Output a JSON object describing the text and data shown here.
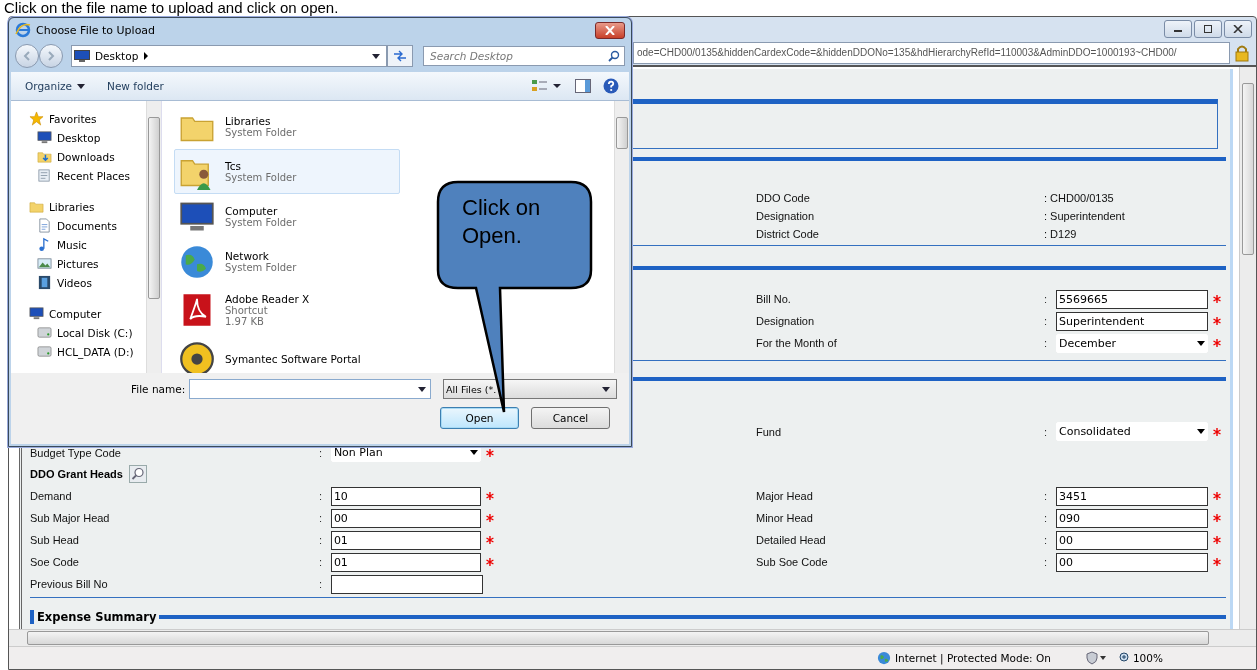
{
  "instruction": "Click on the file name to upload and click on open.",
  "browser": {
    "address": "ode=CHD00/0135&hiddenCardexCode=&hiddenDDONo=135&hdHierarchyRefId=110003&AdminDDO=1000193~CHD00/",
    "ddo_info": [
      {
        "label": "DDO Code",
        "value": ": CHD00/0135"
      },
      {
        "label": "Designation",
        "value": ": Superintendent"
      },
      {
        "label": "District Code",
        "value": ": D129"
      }
    ],
    "bill_rows": [
      {
        "right": {
          "label": "Bill No.",
          "colon": ":",
          "kind": "text",
          "value": "5569665",
          "required": true
        }
      },
      {
        "right": {
          "label": "Designation",
          "colon": ":",
          "kind": "text",
          "value": "Superintendent",
          "required": true
        }
      },
      {
        "right": {
          "label": "For the Month of",
          "colon": ":",
          "kind": "select",
          "value": "December",
          "required": true
        }
      }
    ],
    "fund_rows": [
      {
        "right": {
          "label": "Fund",
          "colon": ":",
          "kind": "select",
          "value": "Consolidated",
          "required": true
        }
      },
      {
        "left": {
          "label": "Budget Type Code",
          "colon": ":",
          "kind": "select",
          "value": "Non Plan",
          "required": true
        }
      }
    ],
    "grant_heads_title": "DDO Grant Heads",
    "grant_rows": [
      {
        "left": {
          "label": "Demand",
          "colon": ":",
          "kind": "text",
          "value": "10",
          "required": true
        },
        "right": {
          "label": "Major Head",
          "colon": ":",
          "kind": "text",
          "value": "3451",
          "required": true
        }
      },
      {
        "left": {
          "label": "Sub Major Head",
          "colon": ":",
          "kind": "text",
          "value": "00",
          "required": true
        },
        "right": {
          "label": "Minor Head",
          "colon": ":",
          "kind": "text",
          "value": "090",
          "required": true
        }
      },
      {
        "left": {
          "label": "Sub Head",
          "colon": ":",
          "kind": "text",
          "value": "01",
          "required": true
        },
        "right": {
          "label": "Detailed Head",
          "colon": ":",
          "kind": "text",
          "value": "00",
          "required": true
        }
      },
      {
        "left": {
          "label": "Soe Code",
          "colon": ":",
          "kind": "text",
          "value": "01",
          "required": true
        },
        "right": {
          "label": "Sub Soe Code",
          "colon": ":",
          "kind": "text",
          "value": "00",
          "required": true
        }
      },
      {
        "left": {
          "label": "Previous Bill No",
          "colon": ":",
          "kind": "text",
          "required": false
        }
      }
    ],
    "next_section": "Expense Summary",
    "status_bar": {
      "zone": "Internet | Protected Mode: On",
      "zoom": "100%"
    }
  },
  "dialog": {
    "title": "Choose File to Upload",
    "location": "Desktop",
    "search_placeholder": "Search Desktop",
    "toolbar": [
      {
        "label": "Organize",
        "menu": true
      },
      {
        "label": "New folder",
        "menu": false
      }
    ],
    "nav": [
      {
        "label": "Favorites",
        "kind": "star",
        "children": [
          {
            "label": "Desktop",
            "kind": "monitor"
          },
          {
            "label": "Downloads",
            "kind": "download"
          },
          {
            "label": "Recent Places",
            "kind": "recent"
          }
        ]
      },
      {
        "label": "Libraries",
        "kind": "folder",
        "children": [
          {
            "label": "Documents",
            "kind": "document"
          },
          {
            "label": "Music",
            "kind": "music"
          },
          {
            "label": "Pictures",
            "kind": "picture"
          },
          {
            "label": "Videos",
            "kind": "film"
          }
        ]
      },
      {
        "label": "Computer",
        "kind": "monitor",
        "children": [
          {
            "label": "Local Disk (C:)",
            "kind": "disk"
          },
          {
            "label": "HCL_DATA (D:)",
            "kind": "disk"
          }
        ]
      }
    ],
    "files": [
      {
        "name": "Libraries",
        "details": [
          "System Folder"
        ],
        "kind": "folder",
        "selected": false
      },
      {
        "name": "Tcs",
        "details": [
          "System Folder"
        ],
        "kind": "userfolder",
        "selected": true
      },
      {
        "name": "Computer",
        "details": [
          "System Folder"
        ],
        "kind": "monitor",
        "selected": false
      },
      {
        "name": "Network",
        "details": [
          "System Folder"
        ],
        "kind": "globe",
        "selected": false
      },
      {
        "name": "Adobe Reader X",
        "details": [
          "Shortcut",
          "1.97 KB"
        ],
        "kind": "pdf",
        "selected": false
      },
      {
        "name": "Symantec Software Portal",
        "kind": "disc",
        "selected": false
      }
    ],
    "file_name_label": "File name:",
    "filter": "All Files (*.",
    "buttons": [
      {
        "label": "Open",
        "default": true
      },
      {
        "label": "Cancel",
        "default": false
      }
    ]
  },
  "callout": {
    "text": "Click on Open."
  }
}
